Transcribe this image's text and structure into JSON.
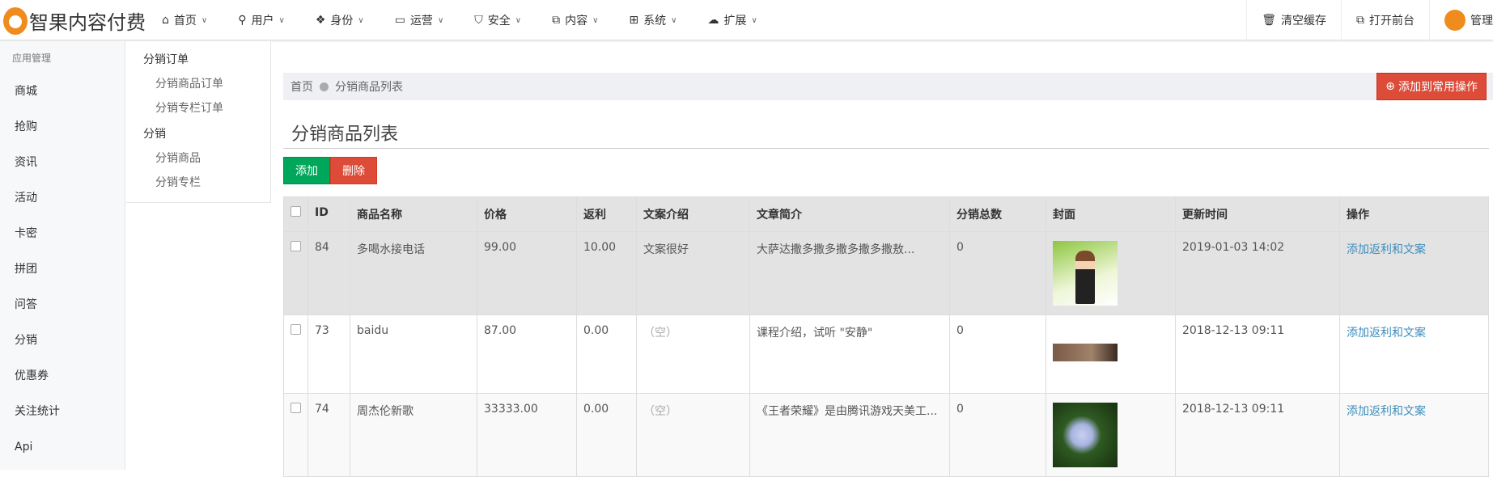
{
  "header": {
    "logo_text": "智果内容付费",
    "nav": [
      {
        "label": "首页",
        "icon": "home-icon"
      },
      {
        "label": "用户",
        "icon": "user-icon"
      },
      {
        "label": "身份",
        "icon": "users-icon"
      },
      {
        "label": "运营",
        "icon": "laptop-icon"
      },
      {
        "label": "安全",
        "icon": "shield-icon"
      },
      {
        "label": "内容",
        "icon": "copy-icon"
      },
      {
        "label": "系统",
        "icon": "windows-icon"
      },
      {
        "label": "扩展",
        "icon": "cloud-icon"
      }
    ],
    "clear_cache": "清空缓存",
    "open_front": "打开前台",
    "admin": "管理"
  },
  "sidebar": {
    "title": "应用管理",
    "items": [
      "商城",
      "抢购",
      "资讯",
      "活动",
      "卡密",
      "拼团",
      "问答",
      "分销",
      "优惠券",
      "关注统计",
      "Api"
    ]
  },
  "submenu": {
    "group1": "分销订单",
    "group1_items": [
      "分销商品订单",
      "分销专栏订单"
    ],
    "group2": "分销",
    "group2_items": [
      "分销商品",
      "分销专栏"
    ]
  },
  "breadcrumb": {
    "home": "首页",
    "current": "分销商品列表",
    "add_favorite": "添加到常用操作"
  },
  "page": {
    "title": "分销商品列表",
    "add": "添加",
    "delete": "删除"
  },
  "table": {
    "headers": [
      "ID",
      "商品名称",
      "价格",
      "返利",
      "文案介绍",
      "文章简介",
      "分销总数",
      "封面",
      "更新时间",
      "操作"
    ],
    "rows": [
      {
        "id": "84",
        "name": "多喝水接电话",
        "price": "99.00",
        "rebate": "10.00",
        "copy": "文案很好",
        "intro": "大萨达撒多撒多撒多撒多撒敖...",
        "total": "0",
        "time": "2019-01-03 14:02",
        "action": "添加返利和文案"
      },
      {
        "id": "73",
        "name": "baidu",
        "price": "87.00",
        "rebate": "0.00",
        "copy": "（空）",
        "intro": "课程介绍，试听 \"安静\"",
        "total": "0",
        "time": "2018-12-13 09:11",
        "action": "添加返利和文案"
      },
      {
        "id": "74",
        "name": "周杰伦新歌",
        "price": "33333.00",
        "rebate": "0.00",
        "copy": "（空）",
        "intro": "《王者荣耀》是由腾讯游戏天美工...",
        "total": "0",
        "time": "2018-12-13 09:11",
        "action": "添加返利和文案"
      }
    ]
  },
  "colors": {
    "add": "#00a65a",
    "danger": "#dd4b39",
    "link": "#3c8dbc",
    "logo": "#f08c1e"
  }
}
